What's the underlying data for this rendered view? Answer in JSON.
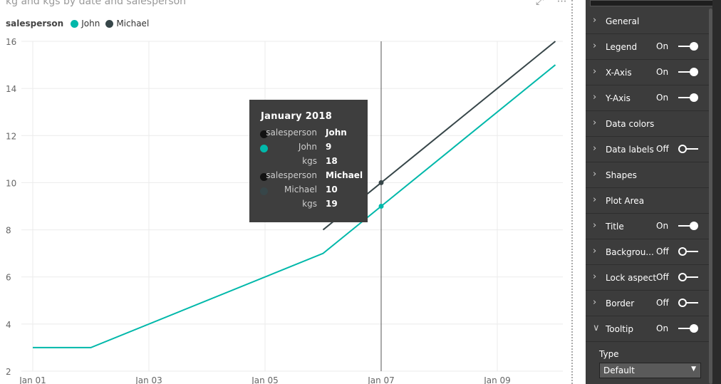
{
  "chart_data": {
    "type": "line",
    "title": "kg and kgs by date and salesperson",
    "legend_title": "salesperson",
    "legend_position": "top-left",
    "x": [
      "Jan 01",
      "Jan 02",
      "Jan 03",
      "Jan 04",
      "Jan 05",
      "Jan 06",
      "Jan 07",
      "Jan 08",
      "Jan 09",
      "Jan 10"
    ],
    "x_tick_labels": [
      "Jan 01",
      "Jan 03",
      "Jan 05",
      "Jan 07",
      "Jan 09"
    ],
    "ylim": [
      2,
      16
    ],
    "y_ticks": [
      2,
      4,
      6,
      8,
      10,
      12,
      14,
      16
    ],
    "grid": true,
    "series": [
      {
        "name": "John",
        "color": "#01B8AA",
        "points": [
          [
            "Jan 01",
            3
          ],
          [
            "Jan 02",
            3
          ],
          [
            "Jan 06",
            7
          ],
          [
            "Jan 07",
            9
          ],
          [
            "Jan 10",
            15
          ]
        ]
      },
      {
        "name": "Michael",
        "color": "#374649",
        "points": [
          [
            "Jan 06",
            8
          ],
          [
            "Jan 07",
            10
          ],
          [
            "Jan 10",
            16
          ]
        ]
      }
    ],
    "hover_x": "Jan 07"
  },
  "tooltip": {
    "title": "January 2018",
    "rows": [
      {
        "key": "salesperson",
        "value": "John",
        "dot": "#111111"
      },
      {
        "key": "John",
        "value": "9",
        "dot": "#01B8AA"
      },
      {
        "key": "kgs",
        "value": "18",
        "dot": ""
      },
      {
        "key": "salesperson",
        "value": "Michael",
        "dot": "#111111"
      },
      {
        "key": "Michael",
        "value": "10",
        "dot": "#374649"
      },
      {
        "key": "kgs",
        "value": "19",
        "dot": ""
      }
    ]
  },
  "visual_icons": {
    "focus": "focus-mode-icon",
    "more": "⋯"
  },
  "format_panel": {
    "sections": [
      {
        "label": "General",
        "state": "",
        "toggle": null
      },
      {
        "label": "Legend",
        "state": "On",
        "toggle": true
      },
      {
        "label": "X-Axis",
        "state": "On",
        "toggle": true
      },
      {
        "label": "Y-Axis",
        "state": "On",
        "toggle": true
      },
      {
        "label": "Data colors",
        "state": "",
        "toggle": null
      },
      {
        "label": "Data labels",
        "state": "Off",
        "toggle": false
      },
      {
        "label": "Shapes",
        "state": "",
        "toggle": null
      },
      {
        "label": "Plot Area",
        "state": "",
        "toggle": null
      },
      {
        "label": "Title",
        "state": "On",
        "toggle": true
      },
      {
        "label": "Backgrou...",
        "state": "Off",
        "toggle": false
      },
      {
        "label": "Lock aspect",
        "state": "Off",
        "toggle": false
      },
      {
        "label": "Border",
        "state": "Off",
        "toggle": false
      },
      {
        "label": "Tooltip",
        "state": "On",
        "toggle": true,
        "expanded": true
      }
    ],
    "tooltip_type_label": "Type",
    "tooltip_type_value": "Default"
  }
}
